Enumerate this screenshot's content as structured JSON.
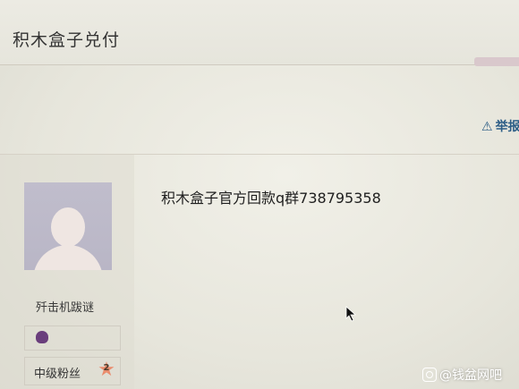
{
  "header": {
    "title": "积木盒子兑付"
  },
  "actions": {
    "report_label": "举报",
    "report_icon": "warning-icon"
  },
  "user": {
    "name": "歼击机跋谜",
    "fan_level": "中级粉丝",
    "fan_badge_number": "2"
  },
  "post": {
    "content": "积木盒子官方回款q群738795358"
  },
  "watermark": {
    "text": "@钱盆网吧"
  }
}
